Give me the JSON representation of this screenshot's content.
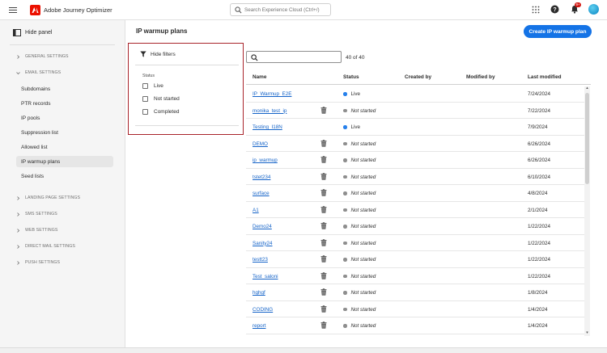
{
  "app": {
    "title": "Adobe Journey Optimizer",
    "logo_icon": "adobe-logo-icon",
    "brand_color": "#eb1000"
  },
  "top_search": {
    "placeholder": "Search Experience Cloud (Ctrl+/)"
  },
  "top_icons": {
    "apps": "apps-grid-icon",
    "help": "help-icon",
    "notifications": "bell-icon",
    "notification_count": "9+",
    "avatar": "avatar"
  },
  "sidebar": {
    "hide_panel_label": "Hide panel",
    "sections": [
      {
        "label": "GENERAL SETTINGS",
        "expanded": false
      },
      {
        "label": "EMAIL SETTINGS",
        "expanded": true
      },
      {
        "label": "LANDING PAGE SETTINGS",
        "expanded": false
      },
      {
        "label": "SMS SETTINGS",
        "expanded": false
      },
      {
        "label": "WEB SETTINGS",
        "expanded": false
      },
      {
        "label": "DIRECT MAIL SETTINGS",
        "expanded": false
      },
      {
        "label": "PUSH SETTINGS",
        "expanded": false
      }
    ],
    "email_items": [
      {
        "label": "Subdomains"
      },
      {
        "label": "PTR records"
      },
      {
        "label": "IP pools"
      },
      {
        "label": "Suppression list"
      },
      {
        "label": "Allowed list"
      },
      {
        "label": "IP warmup plans",
        "active": true
      },
      {
        "label": "Seed lists"
      }
    ]
  },
  "main": {
    "title": "IP warmup plans",
    "create_button": "Create IP warmup plan",
    "accent_color": "#1473e6",
    "filters": {
      "toggle_label": "Hide filters",
      "status_label": "Status",
      "options": [
        {
          "label": "Live",
          "checked": false
        },
        {
          "label": "Not started",
          "checked": false
        },
        {
          "label": "Completed",
          "checked": false
        }
      ]
    },
    "search": {
      "value": ""
    },
    "count": "40 of 40",
    "columns": {
      "name": "Name",
      "status": "Status",
      "created_by": "Created by",
      "modified_by": "Modified by",
      "last_modified": "Last modified"
    },
    "status_colors": {
      "Live": "#2680eb",
      "Not started": "#8e8e8e"
    },
    "rows": [
      {
        "name": "IP_Warmup_E2E",
        "status": "Live",
        "last_modified": "7/24/2024",
        "deletable": false
      },
      {
        "name": "monika_test_ip",
        "status": "Not started",
        "last_modified": "7/22/2024",
        "deletable": true
      },
      {
        "name": "Testing_I18N",
        "status": "Live",
        "last_modified": "7/9/2024",
        "deletable": false
      },
      {
        "name": "DEMO",
        "status": "Not started",
        "last_modified": "6/26/2024",
        "deletable": true
      },
      {
        "name": "ip_warmup",
        "status": "Not started",
        "last_modified": "6/26/2024",
        "deletable": true
      },
      {
        "name": "tstet234",
        "status": "Not started",
        "last_modified": "6/10/2024",
        "deletable": true
      },
      {
        "name": "surface",
        "status": "Not started",
        "last_modified": "4/8/2024",
        "deletable": true
      },
      {
        "name": "A1",
        "status": "Not started",
        "last_modified": "2/1/2024",
        "deletable": true
      },
      {
        "name": "Demo24",
        "status": "Not started",
        "last_modified": "1/22/2024",
        "deletable": true
      },
      {
        "name": "Sanity24",
        "status": "Not started",
        "last_modified": "1/22/2024",
        "deletable": true
      },
      {
        "name": "testt23",
        "status": "Not started",
        "last_modified": "1/22/2024",
        "deletable": true
      },
      {
        "name": "Test_saloni",
        "status": "Not started",
        "last_modified": "1/22/2024",
        "deletable": true
      },
      {
        "name": "hghgf",
        "status": "Not started",
        "last_modified": "1/8/2024",
        "deletable": true
      },
      {
        "name": "CODING",
        "status": "Not started",
        "last_modified": "1/4/2024",
        "deletable": true
      },
      {
        "name": "report",
        "status": "Not started",
        "last_modified": "1/4/2024",
        "deletable": true
      }
    ]
  }
}
